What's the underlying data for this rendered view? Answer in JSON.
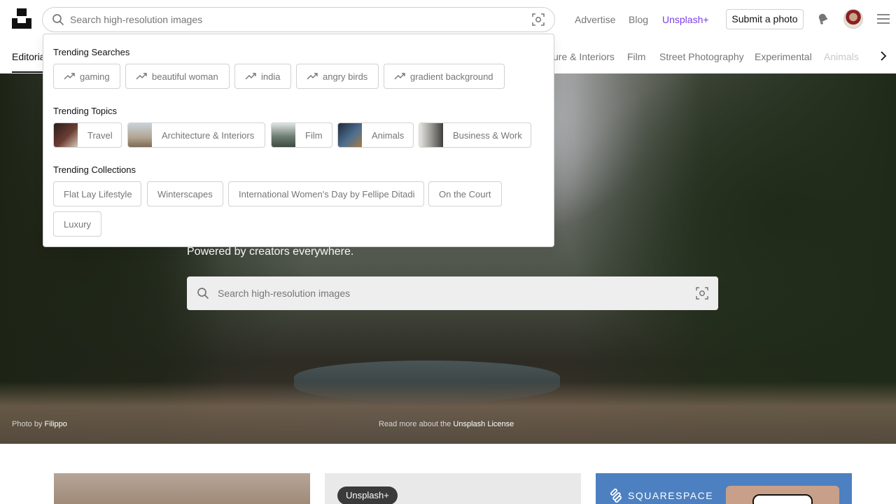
{
  "header": {
    "search_placeholder": "Search high-resolution images",
    "nav": {
      "advertise": "Advertise",
      "blog": "Blog",
      "unsplash_plus": "Unsplash+"
    },
    "submit_label": "Submit a photo"
  },
  "topic_bar": {
    "active": "Editorial",
    "items": [
      "ure & Interiors",
      "Film",
      "Street Photography",
      "Experimental",
      "Animals"
    ]
  },
  "dropdown": {
    "trending_searches": {
      "heading": "Trending Searches",
      "items": [
        "gaming",
        "beautiful woman",
        "india",
        "angry birds",
        "gradient background"
      ]
    },
    "trending_topics": {
      "heading": "Trending Topics",
      "items": [
        "Travel",
        "Architecture & Interiors",
        "Film",
        "Animals",
        "Business & Work"
      ]
    },
    "trending_collections": {
      "heading": "Trending Collections",
      "items": [
        "Flat Lay Lifestyle",
        "Winterscapes",
        "International Women's Day by Fellipe Ditadi",
        "On the Court",
        "Luxury"
      ]
    }
  },
  "hero": {
    "subtitle": "Powered by creators everywhere.",
    "search_placeholder": "Search high-resolution images",
    "credit_prefix": "Photo",
    "credit_by": "by",
    "credit_name": "Filippo",
    "license_prefix": "Read more about the",
    "license_link": "Unsplash License"
  },
  "cards": {
    "plus_badge": "Unsplash+",
    "squarespace": "SQUARESPACE"
  },
  "colors": {
    "accent_plus": "#7b3fe4",
    "border": "#d1d1d1",
    "muted_text": "#767676"
  }
}
